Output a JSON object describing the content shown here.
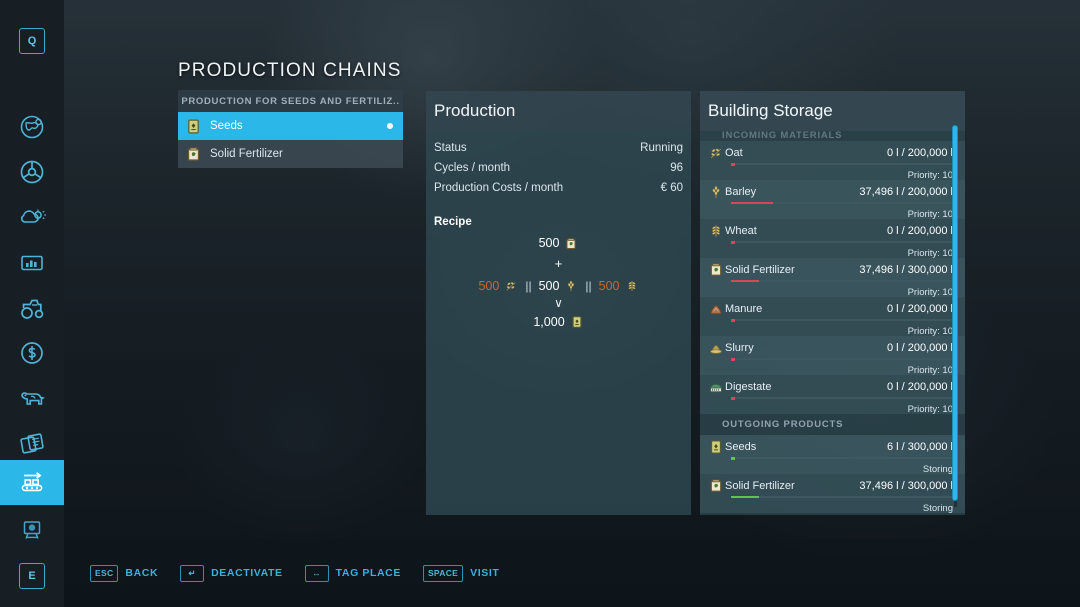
{
  "theme": {
    "accent": "#2bb8e8",
    "panel_bg": "#2f4a52",
    "text": "#e6eef3",
    "muted": "#92a4af",
    "low_stock": "#c8663c",
    "bar_red": "#d9455a",
    "bar_green": "#5fc44a"
  },
  "page_title": "PRODUCTION CHAINS",
  "sidebar": {
    "items": [
      {
        "name": "quick-menu-q",
        "icon": "key-q-box-icon",
        "label": "Q",
        "active": false
      },
      {
        "name": "map-globe",
        "icon": "globe-map-icon",
        "label": "",
        "active": false
      },
      {
        "name": "vehicles-steering",
        "icon": "steering-wheel-icon",
        "label": "",
        "active": false
      },
      {
        "name": "weather",
        "icon": "weather-cloud-sun-icon",
        "label": "",
        "active": false
      },
      {
        "name": "statistics",
        "icon": "bar-chart-icon",
        "label": "",
        "active": false
      },
      {
        "name": "vehicle-overview",
        "icon": "tractor-icon",
        "label": "",
        "active": false
      },
      {
        "name": "finances",
        "icon": "dollar-coin-icon",
        "label": "",
        "active": false
      },
      {
        "name": "animals",
        "icon": "cow-icon",
        "label": "",
        "active": false
      },
      {
        "name": "contracts",
        "icon": "documents-icon",
        "label": "",
        "active": false
      },
      {
        "name": "production-chains",
        "icon": "conveyor-belt-icon",
        "label": "",
        "active": true
      },
      {
        "name": "construction",
        "icon": "easel-screen-icon",
        "label": "",
        "active": false
      },
      {
        "name": "key-e",
        "icon": "key-e-box-icon",
        "label": "E",
        "active": false
      }
    ]
  },
  "production_list": {
    "header": "PRODUCTION FOR SEEDS AND FERTILIZ..",
    "items": [
      {
        "label": "Seeds",
        "icon": "seeds-bag-icon",
        "selected": true,
        "dot": true
      },
      {
        "label": "Solid Fertilizer",
        "icon": "fertilizer-bag-icon",
        "selected": false,
        "dot": false
      }
    ]
  },
  "production": {
    "title": "Production",
    "stats": [
      {
        "key": "Status",
        "value": "Running"
      },
      {
        "key": "Cycles / month",
        "value": "96"
      },
      {
        "key": "Production Costs / month",
        "value": "€ 60"
      }
    ],
    "recipe_label": "Recipe",
    "recipe": {
      "inputs_line1": [
        {
          "amount": "500",
          "icon": "fertilizer-bag-icon",
          "low": false
        }
      ],
      "operator": "+",
      "inputs_line2": [
        {
          "amount": "500",
          "icon": "oat-grain-icon",
          "low": true
        },
        {
          "amount": "500",
          "icon": "barley-grain-icon",
          "low": false
        },
        {
          "amount": "500",
          "icon": "wheat-grain-icon",
          "low": true
        }
      ],
      "separator": "||",
      "arrow": "∨",
      "output": {
        "amount": "1,000",
        "icon": "seeds-bag-icon"
      }
    }
  },
  "storage": {
    "title": "Building Storage",
    "sections": [
      {
        "header": "INCOMING MATERIALS",
        "clipped": true,
        "rows": [
          {
            "name": "Oat",
            "icon": "oat-grain-icon",
            "amount": "0 l / 200,000 l",
            "sub": "Priority: 10",
            "fill_pct": 1.5,
            "bar_color": "#d9455a"
          },
          {
            "name": "Barley",
            "icon": "barley-grain-icon",
            "amount": "37,496 l / 200,000 l",
            "sub": "Priority: 10",
            "fill_pct": 19,
            "bar_color": "#d9455a"
          },
          {
            "name": "Wheat",
            "icon": "wheat-grain-icon",
            "amount": "0 l / 200,000 l",
            "sub": "Priority: 10",
            "fill_pct": 1.5,
            "bar_color": "#d9455a"
          },
          {
            "name": "Solid Fertilizer",
            "icon": "fertilizer-bag-icon",
            "amount": "37,496 l / 300,000 l",
            "sub": "Priority: 10",
            "fill_pct": 12.5,
            "bar_color": "#d9455a"
          },
          {
            "name": "Manure",
            "icon": "manure-pile-icon",
            "amount": "0 l / 200,000 l",
            "sub": "Priority: 10",
            "fill_pct": 1.5,
            "bar_color": "#d9455a"
          },
          {
            "name": "Slurry",
            "icon": "slurry-splash-icon",
            "amount": "0 l / 200,000 l",
            "sub": "Priority: 10",
            "fill_pct": 1.5,
            "bar_color": "#d9455a"
          },
          {
            "name": "Digestate",
            "icon": "digestate-tank-icon",
            "amount": "0 l / 200,000 l",
            "sub": "Priority: 10",
            "fill_pct": 1.5,
            "bar_color": "#d9455a"
          }
        ]
      },
      {
        "header": "OUTGOING PRODUCTS",
        "clipped": false,
        "rows": [
          {
            "name": "Seeds",
            "icon": "seeds-bag-icon",
            "amount": "6 l / 300,000 l",
            "sub": "Storing",
            "fill_pct": 1.5,
            "bar_color": "#5fc44a"
          },
          {
            "name": "Solid Fertilizer",
            "icon": "fertilizer-bag-icon",
            "amount": "37,496 l / 300,000 l",
            "sub": "Storing",
            "fill_pct": 12.5,
            "bar_color": "#5fc44a"
          }
        ]
      }
    ]
  },
  "help_bar": [
    {
      "key": "ESC",
      "icon": "esc-key-icon",
      "label": "BACK"
    },
    {
      "key": "↵",
      "icon": "enter-key-icon",
      "label": "DEACTIVATE"
    },
    {
      "key": "↔",
      "icon": "left-right-key-icon",
      "label": "TAG PLACE"
    },
    {
      "key": "SPACE",
      "icon": "space-key-icon",
      "label": "VISIT"
    }
  ]
}
